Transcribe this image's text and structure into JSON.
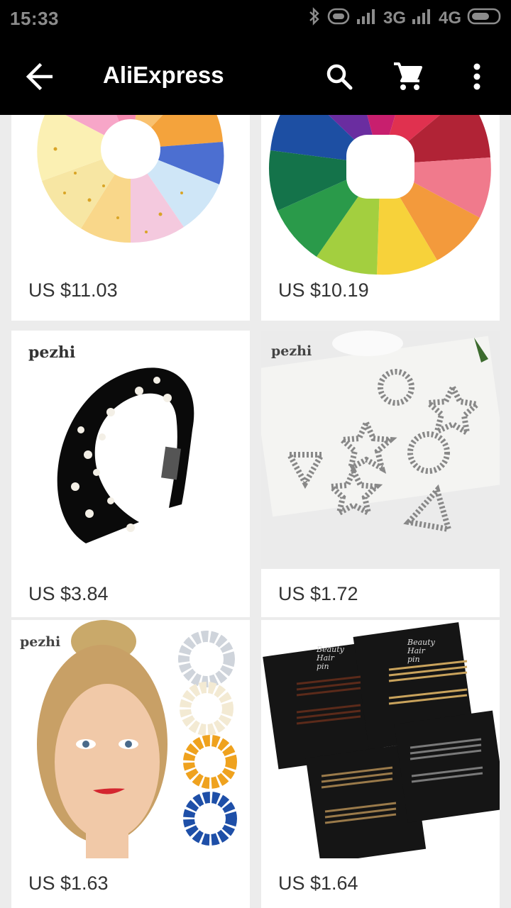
{
  "status_bar": {
    "time": "15:33",
    "network_1": "3G",
    "network_2": "4G"
  },
  "toolbar": {
    "title": "AliExpress",
    "back_icon": "arrow-back-icon",
    "search_icon": "search-icon",
    "cart_icon": "cart-icon",
    "more_icon": "more-vert-icon"
  },
  "products": [
    {
      "price": "US $11.03",
      "image": "colorful organza gift bags with gold stars, arranged in a circle"
    },
    {
      "price": "US $10.19",
      "image": "rainbow organza gift bags arranged in a circle"
    },
    {
      "price": "US $3.84",
      "image": "black velvet padded headband with pearls",
      "brand_mark": "pezhi"
    },
    {
      "price": "US $1.72",
      "image": "metal hair clips in star, circle and triangle shapes",
      "brand_mark": "pezhi"
    },
    {
      "price": "US $1.63",
      "image": "model wearing pearl hair ties in bun, pearl scrunchies",
      "brand_mark": "pezhi"
    },
    {
      "price": "US $1.64",
      "image": "bobby pins on black cards",
      "card_text": "Beauty Hair pin"
    }
  ],
  "colors": {
    "toolbar_bg": "#000000",
    "page_bg": "#ececec",
    "card_bg": "#ffffff",
    "price_text": "#333333"
  }
}
